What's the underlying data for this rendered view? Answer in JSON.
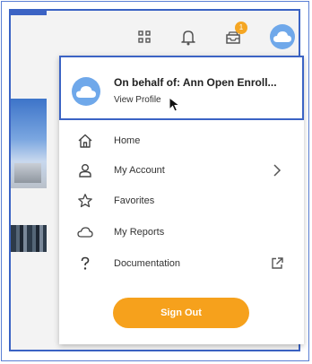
{
  "profile": {
    "name": "On behalf of: Ann Open Enroll...",
    "link": "View Profile"
  },
  "notifications": {
    "badge": "1"
  },
  "menu": {
    "items": [
      {
        "label": "Home",
        "icon": "home-icon"
      },
      {
        "label": "My Account",
        "icon": "person-icon",
        "right": "chevron-right-icon"
      },
      {
        "label": "Favorites",
        "icon": "star-icon"
      },
      {
        "label": "My Reports",
        "icon": "cloud-icon"
      },
      {
        "label": "Documentation",
        "icon": "question-icon",
        "right": "external-link-icon"
      }
    ],
    "signout": "Sign Out"
  },
  "colors": {
    "accent": "#f6a11c",
    "highlight_border": "#3b63c4",
    "avatar": "#6fa8ea"
  }
}
